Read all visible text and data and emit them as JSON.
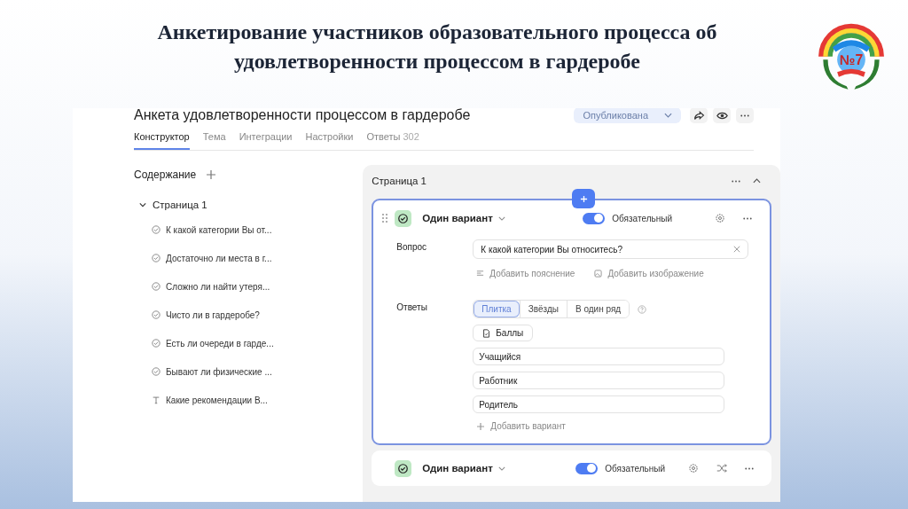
{
  "slide": {
    "title": "Анкетирование участников образовательного процесса об удовлетворенности процессом в гардеробе",
    "logo": {
      "text": "№7"
    }
  },
  "form": {
    "title": "Анкета удовлетворенности процессом в гардеробе",
    "status": "Опубликована",
    "tabs": [
      {
        "label": "Конструктор",
        "selected": true
      },
      {
        "label": "Тема",
        "selected": false
      },
      {
        "label": "Интеграции",
        "selected": false
      },
      {
        "label": "Настройки",
        "selected": false
      },
      {
        "label": "Ответы",
        "count": "302",
        "selected": false
      }
    ]
  },
  "sidebar": {
    "heading": "Содержание",
    "pages": [
      {
        "label": "Страница 1",
        "expanded": true,
        "children": [
          {
            "kind": "choice",
            "label": "К какой категории Вы от..."
          },
          {
            "kind": "choice",
            "label": "Достаточно ли места в г..."
          },
          {
            "kind": "choice",
            "label": "Сложно ли найти утеря..."
          },
          {
            "kind": "choice",
            "label": "Чисто ли в гардеробе?"
          },
          {
            "kind": "choice",
            "label": "Есть ли очереди в гарде..."
          },
          {
            "kind": "choice",
            "label": "Бывают ли физические ..."
          },
          {
            "kind": "text",
            "label": "Какие рекомендации В..."
          }
        ]
      }
    ]
  },
  "page": {
    "title": "Страница 1",
    "questions": [
      {
        "type": "Один вариант",
        "required": true,
        "required_label": "Обязательный",
        "expanded": true,
        "question_label": "Вопрос",
        "question": "К какой категории Вы относитесь?",
        "add_hint": "Добавить пояснение",
        "add_image": "Добавить изображение",
        "answers_label": "Ответы",
        "views": [
          {
            "label": "Плитка",
            "selected": true
          },
          {
            "label": "Звёзды",
            "selected": false
          },
          {
            "label": "В один ряд",
            "selected": false
          }
        ],
        "scores": "Баллы",
        "options": [
          "Учащийся",
          "Работник",
          "Родитель"
        ],
        "add_option": "Добавить вариант"
      },
      {
        "type": "Один вариант",
        "required": true,
        "required_label": "Обязательный",
        "expanded": false
      }
    ]
  }
}
